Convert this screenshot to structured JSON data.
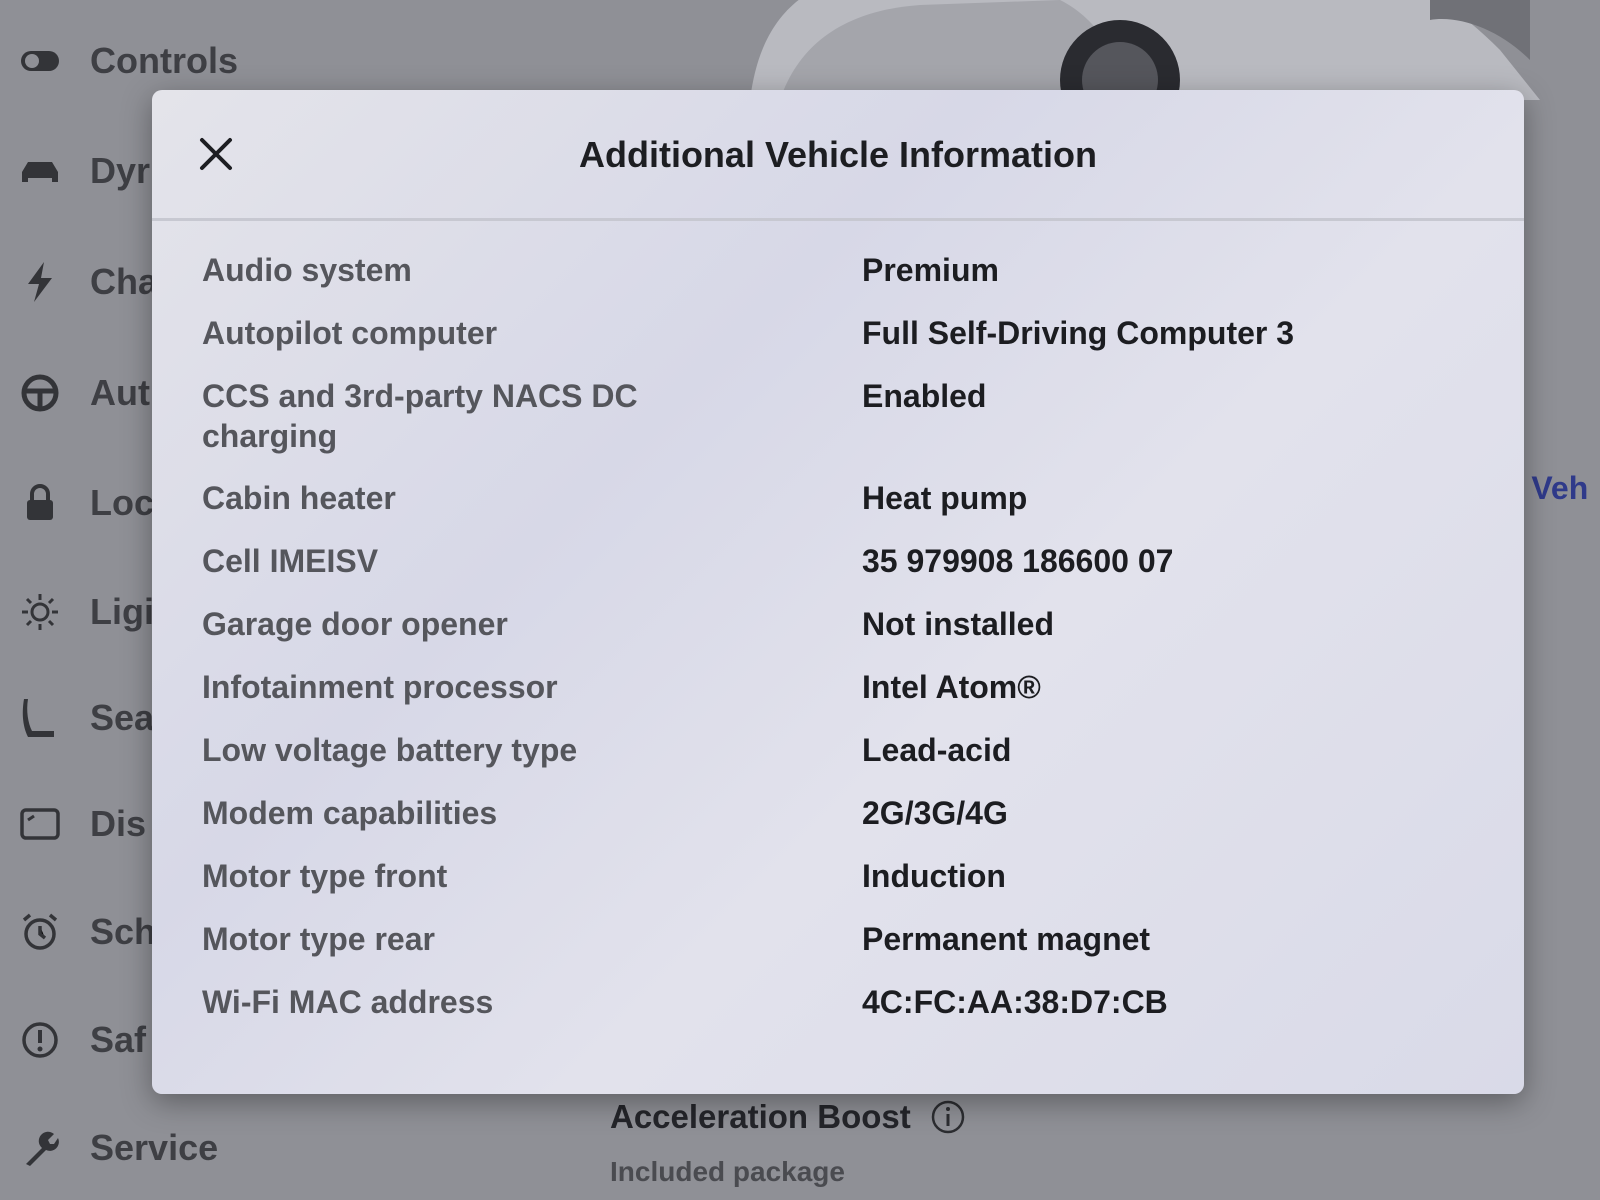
{
  "sidebar": {
    "items": [
      {
        "label": "Controls",
        "icon": "toggle-icon"
      },
      {
        "label": "Dyr",
        "icon": "car-icon"
      },
      {
        "label": "Cha",
        "icon": "lightning-icon"
      },
      {
        "label": "Aut",
        "icon": "steering-wheel-icon"
      },
      {
        "label": "Loc",
        "icon": "lock-icon"
      },
      {
        "label": "Ligi",
        "icon": "sun-icon"
      },
      {
        "label": "Sea",
        "icon": "seat-icon"
      },
      {
        "label": "Dis",
        "icon": "display-icon"
      },
      {
        "label": "Sch",
        "icon": "alarm-clock-icon"
      },
      {
        "label": "Saf",
        "icon": "alert-circle-icon"
      },
      {
        "label": "Service",
        "icon": "wrench-icon"
      }
    ]
  },
  "background": {
    "link_fragment": "r Veh",
    "feature_title": "Acceleration Boost",
    "feature_subtitle": "Included package"
  },
  "modal": {
    "title": "Additional Vehicle Information",
    "close_icon": "close-icon",
    "rows": [
      {
        "key": "Audio system",
        "value": "Premium"
      },
      {
        "key": "Autopilot computer",
        "value": "Full Self-Driving Computer 3"
      },
      {
        "key": "CCS and 3rd-party NACS DC charging",
        "value": "Enabled"
      },
      {
        "key": "Cabin heater",
        "value": "Heat pump"
      },
      {
        "key": "Cell IMEISV",
        "value": "35 979908 186600 07"
      },
      {
        "key": "Garage door opener",
        "value": "Not installed"
      },
      {
        "key": "Infotainment processor",
        "value": "Intel Atom®"
      },
      {
        "key": "Low voltage battery type",
        "value": "Lead-acid"
      },
      {
        "key": "Modem capabilities",
        "value": "2G/3G/4G"
      },
      {
        "key": "Motor type front",
        "value": "Induction"
      },
      {
        "key": "Motor type rear",
        "value": "Permanent magnet"
      },
      {
        "key": "Wi-Fi MAC address",
        "value": "4C:FC:AA:38:D7:CB"
      }
    ]
  },
  "colors": {
    "background": "#8f9096",
    "modal": "#e0e0e8",
    "link": "#2f3a8a"
  }
}
